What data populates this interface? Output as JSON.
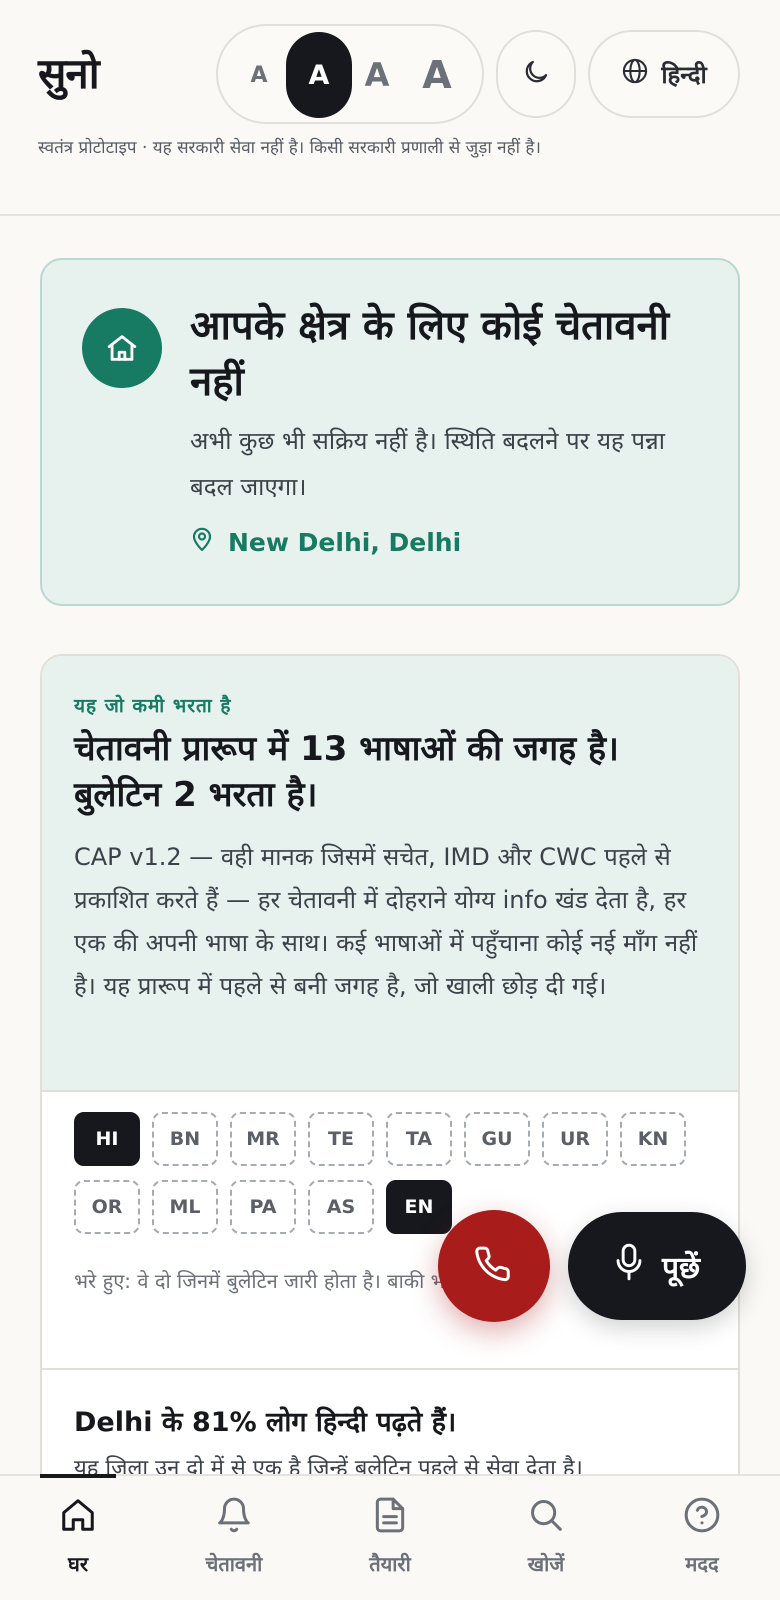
{
  "header": {
    "logo": "सुनो",
    "text_size": {
      "options": [
        "A",
        "A",
        "A",
        "A"
      ],
      "selected_index": 1
    },
    "language": "हिन्दी",
    "disclaimer": "स्वतंत्र प्रोटोटाइप · यह सरकारी सेवा नहीं है। किसी सरकारी प्रणाली से जुड़ा नहीं है।"
  },
  "status": {
    "title": "आपके क्षेत्र के लिए कोई चेतावनी नहीं",
    "body": "अभी कुछ भी सक्रिय नहीं है। स्थिति बदलने पर यह पन्ना बदल जाएगा।",
    "location": "New Delhi, Delhi",
    "icon": "home-icon"
  },
  "gap": {
    "kicker": "यह जो कमी भरता है",
    "title": "चेतावनी प्रारूप में 13 भाषाओं की जगह है। बुलेटिन 2 भरता है।",
    "body": "CAP v1.2 — वही मानक जिसमें सचेत, IMD और CWC पहले से प्रकाशित करते हैं — हर चेतावनी में दोहराने योग्य info खंड देता है, हर एक की अपनी भाषा के साथ। कई भाषाओं में पहुँचाना कोई नई माँग नहीं है। यह प्रारूप में पहले से बनी जगह है, जो खाली छोड़ दी गई।",
    "languages": [
      {
        "code": "HI",
        "filled": true
      },
      {
        "code": "BN",
        "filled": false
      },
      {
        "code": "MR",
        "filled": false
      },
      {
        "code": "TE",
        "filled": false
      },
      {
        "code": "TA",
        "filled": false
      },
      {
        "code": "GU",
        "filled": false
      },
      {
        "code": "UR",
        "filled": false
      },
      {
        "code": "KN",
        "filled": false
      },
      {
        "code": "OR",
        "filled": false
      },
      {
        "code": "ML",
        "filled": false
      },
      {
        "code": "PA",
        "filled": false
      },
      {
        "code": "AS",
        "filled": false
      },
      {
        "code": "EN",
        "filled": true
      }
    ],
    "note": "भरे हुए: वे दो जिनमें बुलेटिन जारी होता है। बाकी भरता है।",
    "stat_title": "Delhi के 81% लोग हिन्दी पढ़ते हैं।",
    "stat_body": "यह जिला उन दो में से एक है जिन्हें बुलेटिन पहले से सेवा देता है।"
  },
  "fab": {
    "ask_label": "पूछें",
    "call_icon": "phone-icon",
    "mic_icon": "mic-icon"
  },
  "nav": {
    "items": [
      {
        "label": "घर",
        "icon": "home-icon"
      },
      {
        "label": "चेतावनी",
        "icon": "bell-icon"
      },
      {
        "label": "तैयारी",
        "icon": "document-icon"
      },
      {
        "label": "खोजें",
        "icon": "search-icon"
      },
      {
        "label": "मदद",
        "icon": "help-icon"
      }
    ],
    "active_index": 0
  },
  "colors": {
    "accent": "#177a62",
    "alert_red": "#a81c1c",
    "ink": "#16181d",
    "mint_bg": "#e7f2ef"
  }
}
